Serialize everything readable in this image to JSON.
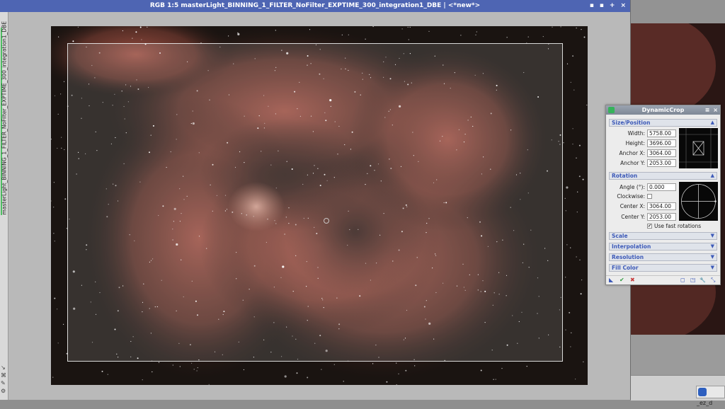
{
  "image_window": {
    "title": "RGB 1:5 masterLight_BINNING_1_FILTER_NoFilter_EXPTIME_300_integration1_DBE | <*new*>",
    "controls": [
      "▪",
      "▪",
      "+",
      "×"
    ],
    "side_tab_label": "masterLight_BINNING_1_FILTER_NoFilter_EXPTIME_300_integration1_DBE",
    "side_tools": [
      "↘",
      "⌘",
      "✎",
      "⚙"
    ]
  },
  "shaded_window": {
    "label": "_ez_d"
  },
  "dynamic_crop": {
    "title": "DynamicCrop",
    "title_buttons": [
      "≡",
      "×"
    ],
    "size_position": {
      "header": "Size/Position",
      "width_label": "Width:",
      "width": "5758.00",
      "height_label": "Height:",
      "height": "3696.00",
      "anchor_x_label": "Anchor X:",
      "anchor_x": "3064.00",
      "anchor_y_label": "Anchor Y:",
      "anchor_y": "2053.00"
    },
    "rotation": {
      "header": "Rotation",
      "angle_label": "Angle (°):",
      "angle": "0.000",
      "clockwise_label": "Clockwise:",
      "center_x_label": "Center X:",
      "center_x": "3064.00",
      "center_y_label": "Center Y:",
      "center_y": "2053.00",
      "fast_rotations_label": "Use fast rotations",
      "fast_rotations_checked": true
    },
    "collapsed_sections": [
      "Scale",
      "Interpolation",
      "Resolution",
      "Fill Color"
    ],
    "footer_left": [
      "◣",
      "✔",
      "✖"
    ],
    "footer_right": [
      "◻",
      "◳",
      "🔧",
      "⤡"
    ]
  },
  "colors": {
    "title_blue": "#4e65b3",
    "section_text": "#3d5ab8",
    "nebula": "#b0584a"
  }
}
